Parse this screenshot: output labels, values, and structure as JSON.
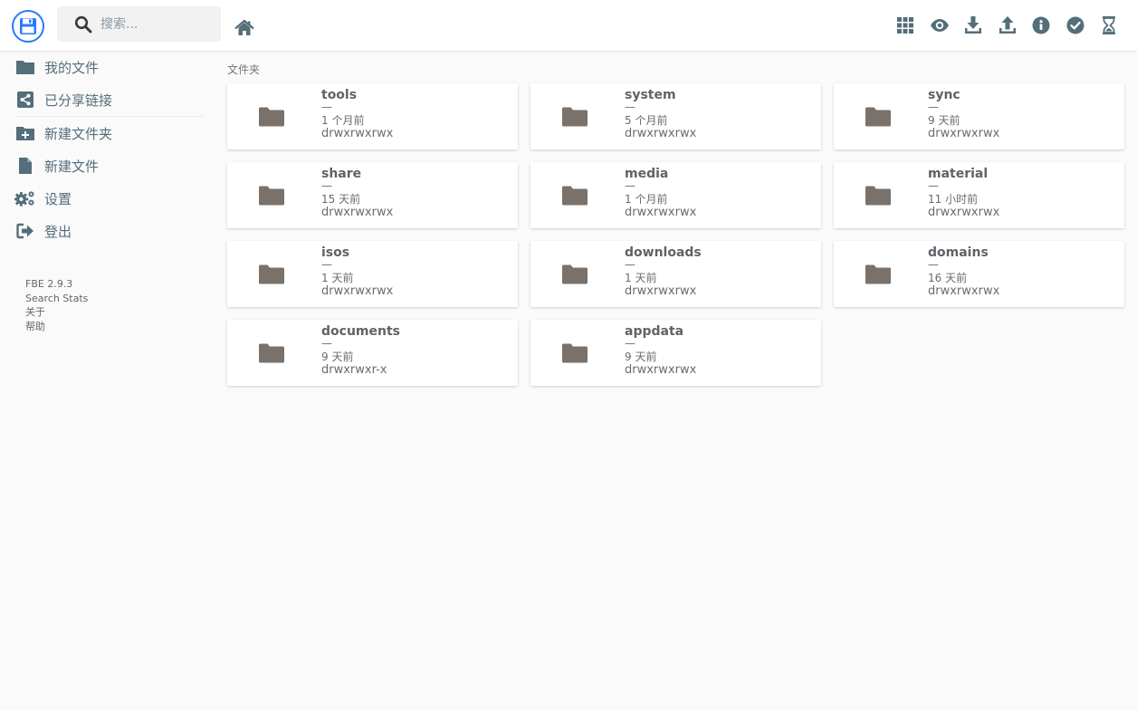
{
  "header": {
    "search_placeholder": "搜索...",
    "actions": [
      {
        "name": "grid-view-icon"
      },
      {
        "name": "eye-icon"
      },
      {
        "name": "download-icon"
      },
      {
        "name": "upload-icon"
      },
      {
        "name": "info-icon"
      },
      {
        "name": "check-circle-icon"
      },
      {
        "name": "hourglass-icon"
      }
    ]
  },
  "sidebar": {
    "items": [
      {
        "label": "我的文件",
        "icon": "folder-icon"
      },
      {
        "label": "已分享链接",
        "icon": "share-icon"
      },
      {
        "label": "新建文件夹",
        "icon": "new-folder-icon"
      },
      {
        "label": "新建文件",
        "icon": "file-icon"
      },
      {
        "label": "设置",
        "icon": "gears-icon"
      },
      {
        "label": "登出",
        "icon": "logout-icon"
      }
    ],
    "credits": [
      "FBE 2.9.3",
      "Search Stats",
      "关于",
      "帮助"
    ]
  },
  "main": {
    "section_title": "文件夹",
    "folders": [
      {
        "name": "tools",
        "size": "—",
        "modified": "1 个月前",
        "perm": "drwxrwxrwx"
      },
      {
        "name": "system",
        "size": "—",
        "modified": "5 个月前",
        "perm": "drwxrwxrwx"
      },
      {
        "name": "sync",
        "size": "—",
        "modified": "9 天前",
        "perm": "drwxrwxrwx"
      },
      {
        "name": "share",
        "size": "—",
        "modified": "15 天前",
        "perm": "drwxrwxrwx"
      },
      {
        "name": "media",
        "size": "—",
        "modified": "1 个月前",
        "perm": "drwxrwxrwx"
      },
      {
        "name": "material",
        "size": "—",
        "modified": "11 小时前",
        "perm": "drwxrwxrwx"
      },
      {
        "name": "isos",
        "size": "—",
        "modified": "1 天前",
        "perm": "drwxrwxrwx"
      },
      {
        "name": "downloads",
        "size": "—",
        "modified": "1 天前",
        "perm": "drwxrwxrwx"
      },
      {
        "name": "domains",
        "size": "—",
        "modified": "16 天前",
        "perm": "drwxrwxrwx"
      },
      {
        "name": "documents",
        "size": "—",
        "modified": "9 天前",
        "perm": "drwxrwxr-x"
      },
      {
        "name": "appdata",
        "size": "—",
        "modified": "9 天前",
        "perm": "drwxrwxrwx"
      }
    ]
  },
  "colors": {
    "accent": "#2979ff",
    "icon": "#546e7a",
    "folder": "#7a716b",
    "background": "#fafafa"
  }
}
